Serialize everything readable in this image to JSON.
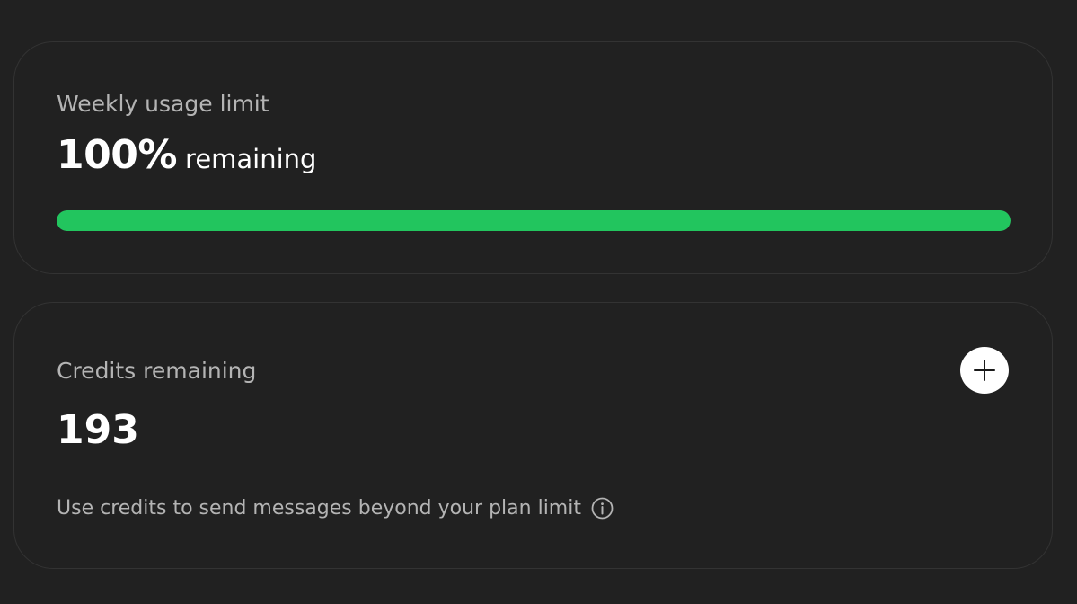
{
  "usage": {
    "title": "Weekly usage limit",
    "percent_text": "100%",
    "suffix": "remaining",
    "progress": 1.0,
    "progress_color": "#22c55e"
  },
  "credits": {
    "title": "Credits remaining",
    "value": "193",
    "add_icon": "plus-icon",
    "note": "Use credits to send messages beyond your plan limit",
    "info_icon": "info-icon"
  },
  "colors": {
    "background": "#212121",
    "card_border": "#333333",
    "muted_text": "#b4b4b4",
    "primary_text": "#ffffff"
  }
}
